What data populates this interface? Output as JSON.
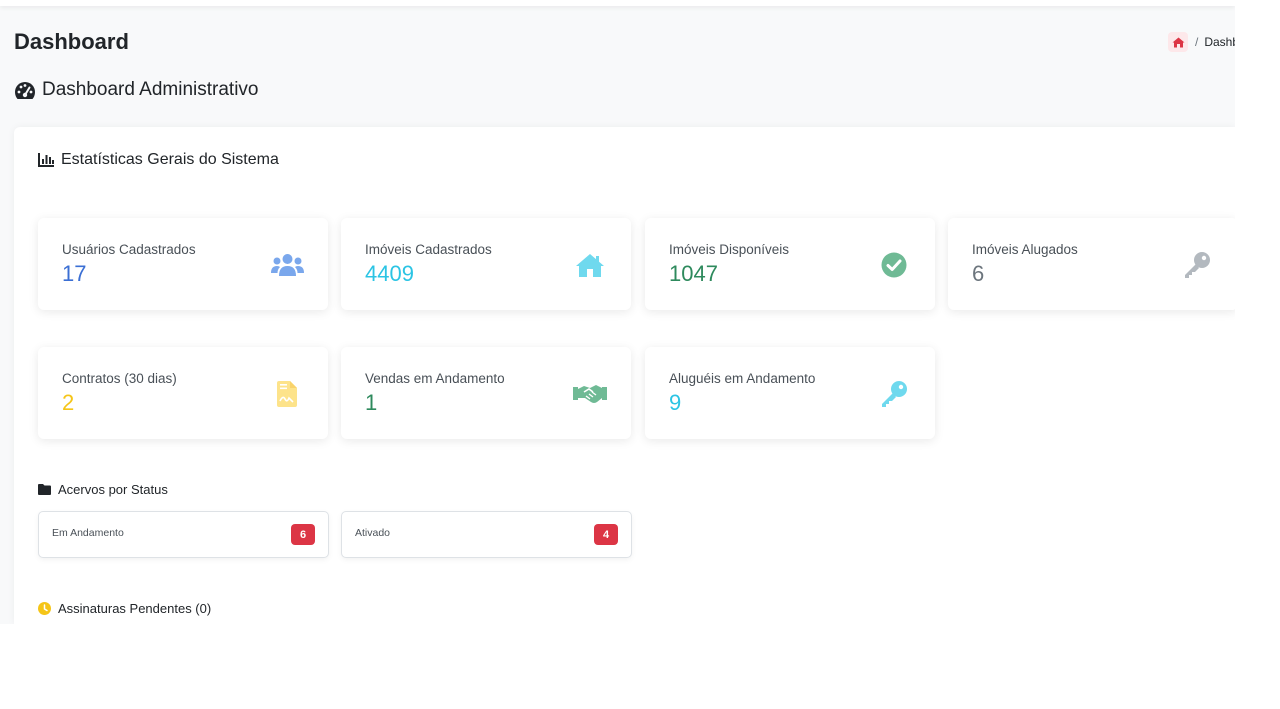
{
  "colors": {
    "blue": "#3b6fd4",
    "cyan": "#2bc4e4",
    "green": "#2e8a5d",
    "gray": "#6c757d",
    "yellow": "#f5c518",
    "red": "#dc3545"
  },
  "header": {
    "title": "Dashboard",
    "breadcrumb": {
      "home_icon": "home-icon",
      "separator": "/",
      "current": "Dashboard"
    }
  },
  "main": {
    "section_title": "Dashboard Administrativo",
    "section_icon": "tachometer-icon",
    "stats_panel": {
      "title": "Estatísticas Gerais do Sistema",
      "title_icon": "bar-chart-icon",
      "cards": [
        {
          "label": "Usuários Cadastrados",
          "value": "17",
          "icon": "users-icon",
          "color": "#3b6fd4"
        },
        {
          "label": "Imóveis Cadastrados",
          "value": "4409",
          "icon": "home-icon",
          "color": "#2bc4e4"
        },
        {
          "label": "Imóveis Disponíveis",
          "value": "1047",
          "icon": "check-circle-icon",
          "color": "#2e8a5d"
        },
        {
          "label": "Imóveis Alugados",
          "value": "6",
          "icon": "key-icon",
          "color": "#6c757d"
        },
        {
          "label": "Contratos (30 dias)",
          "value": "2",
          "icon": "file-contract-icon",
          "color": "#f5c518"
        },
        {
          "label": "Vendas em Andamento",
          "value": "1",
          "icon": "handshake-icon",
          "color": "#2e8a5d"
        },
        {
          "label": "Aluguéis em Andamento",
          "value": "9",
          "icon": "key-icon",
          "color": "#2bc4e4"
        }
      ]
    },
    "acervos": {
      "title": "Acervos por Status",
      "title_icon": "folder-icon",
      "items": [
        {
          "label": "Em Andamento",
          "count": "6"
        },
        {
          "label": "Ativado",
          "count": "4"
        }
      ]
    },
    "assinaturas": {
      "title": "Assinaturas Pendentes (0)",
      "title_icon": "clock-icon"
    }
  }
}
